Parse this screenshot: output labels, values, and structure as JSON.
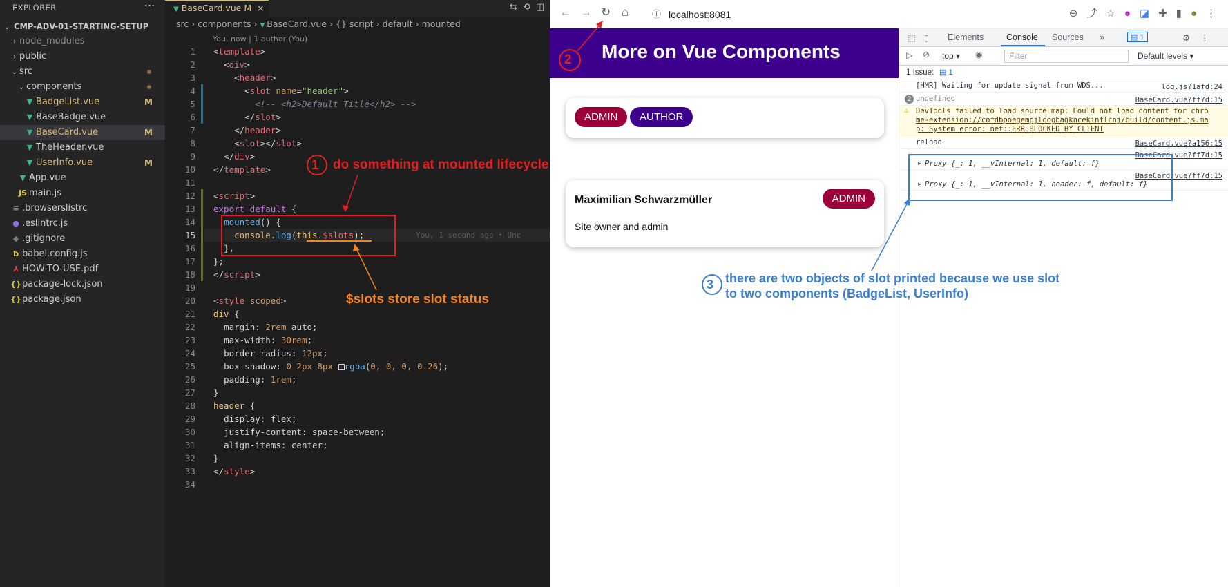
{
  "explorer": {
    "title": "EXPLORER",
    "more_icon": "ellipsis-icon",
    "project": "CMP-ADV-01-STARTING-SETUP",
    "items": [
      {
        "label": "node_modules",
        "kind": "folder",
        "depth": 1,
        "state": "collapsed",
        "badge": "",
        "muted": true
      },
      {
        "label": "public",
        "kind": "folder",
        "depth": 1,
        "state": "collapsed",
        "badge": "",
        "muted": false
      },
      {
        "label": "src",
        "kind": "folder",
        "depth": 1,
        "state": "expanded",
        "badge": "dot",
        "muted": false
      },
      {
        "label": "components",
        "kind": "folder",
        "depth": 2,
        "state": "expanded",
        "badge": "dot",
        "muted": false
      },
      {
        "label": "BadgeList.vue",
        "kind": "vue",
        "depth": 3,
        "badge": "M",
        "modified": true
      },
      {
        "label": "BaseBadge.vue",
        "kind": "vue",
        "depth": 3,
        "badge": "",
        "modified": false
      },
      {
        "label": "BaseCard.vue",
        "kind": "vue",
        "depth": 3,
        "badge": "M",
        "modified": true,
        "selected": true
      },
      {
        "label": "TheHeader.vue",
        "kind": "vue",
        "depth": 3,
        "badge": "",
        "modified": false
      },
      {
        "label": "UserInfo.vue",
        "kind": "vue",
        "depth": 3,
        "badge": "M",
        "modified": true
      },
      {
        "label": "App.vue",
        "kind": "vue",
        "depth": 2,
        "badge": "",
        "modified": false
      },
      {
        "label": "main.js",
        "kind": "js",
        "depth": 2,
        "badge": "",
        "modified": false
      },
      {
        "label": ".browserslistrc",
        "kind": "list",
        "depth": 1,
        "badge": "",
        "modified": false
      },
      {
        "label": ".eslintrc.js",
        "kind": "gear",
        "depth": 1,
        "badge": "",
        "modified": false
      },
      {
        "label": ".gitignore",
        "kind": "git",
        "depth": 1,
        "badge": "",
        "modified": false
      },
      {
        "label": "babel.config.js",
        "kind": "babel",
        "depth": 1,
        "badge": "",
        "modified": false
      },
      {
        "label": "HOW-TO-USE.pdf",
        "kind": "pdf",
        "depth": 1,
        "badge": "",
        "modified": false
      },
      {
        "label": "package-lock.json",
        "kind": "json",
        "depth": 1,
        "badge": "",
        "modified": false
      },
      {
        "label": "package.json",
        "kind": "json",
        "depth": 1,
        "badge": "",
        "modified": false
      }
    ]
  },
  "editor": {
    "tab": {
      "label": "BaseCard.vue",
      "status": "M",
      "close": "×"
    },
    "breadcrumbs": [
      "src",
      "components",
      "BaseCard.vue",
      "{} script",
      "default",
      "mounted"
    ],
    "blame_header": "You, now | 1 author (You)",
    "inline_blame": "You, 1 second ago • Unc",
    "active_line": 15,
    "lines": [
      {
        "n": 1,
        "html": "<span class='t-punc'>&lt;</span><span class='t-tag'>template</span><span class='t-punc'>&gt;</span>"
      },
      {
        "n": 2,
        "html": "  <span class='t-punc'>&lt;</span><span class='t-tag'>div</span><span class='t-punc'>&gt;</span>"
      },
      {
        "n": 3,
        "html": "    <span class='t-punc'>&lt;</span><span class='t-tag'>header</span><span class='t-punc'>&gt;</span>"
      },
      {
        "n": 4,
        "html": "      <span class='t-punc'>&lt;</span><span class='t-tag'>slot</span> <span class='t-attr'>name</span><span class='t-punc'>=</span><span class='t-str'>\"header\"</span><span class='t-punc'>&gt;</span>"
      },
      {
        "n": 5,
        "html": "        <span class='t-com'>&lt;!-- &lt;h2&gt;Default Title&lt;/h2&gt; --&gt;</span>"
      },
      {
        "n": 6,
        "html": "      <span class='t-punc'>&lt;/</span><span class='t-tag'>slot</span><span class='t-punc'>&gt;</span>"
      },
      {
        "n": 7,
        "html": "    <span class='t-punc'>&lt;/</span><span class='t-tag'>header</span><span class='t-punc'>&gt;</span>"
      },
      {
        "n": 8,
        "html": "    <span class='t-punc'>&lt;</span><span class='t-tag'>slot</span><span class='t-punc'>&gt;&lt;/</span><span class='t-tag'>slot</span><span class='t-punc'>&gt;</span>"
      },
      {
        "n": 9,
        "html": "  <span class='t-punc'>&lt;/</span><span class='t-tag'>div</span><span class='t-punc'>&gt;</span>"
      },
      {
        "n": 10,
        "html": "<span class='t-punc'>&lt;/</span><span class='t-tag'>template</span><span class='t-punc'>&gt;</span>"
      },
      {
        "n": 11,
        "html": ""
      },
      {
        "n": 12,
        "html": "<span class='t-punc'>&lt;</span><span class='t-tag'>script</span><span class='t-punc'>&gt;</span>"
      },
      {
        "n": 13,
        "html": "<span class='t-kw'>export default</span> <span class='t-punc'>{</span>"
      },
      {
        "n": 14,
        "html": "  <span class='t-fn'>mounted</span><span class='t-punc'>() {</span>"
      },
      {
        "n": 15,
        "html": "    <span class='t-prop'>console</span><span class='t-punc'>.</span><span class='t-fn'>log</span><span class='t-punc'>(</span><span class='t-this'>this</span><span class='t-punc'>.</span><span class='t-slots'>$slots</span><span class='t-punc'>);</span>"
      },
      {
        "n": 16,
        "html": "  <span class='t-punc'>},</span>"
      },
      {
        "n": 17,
        "html": "<span class='t-punc'>};</span>"
      },
      {
        "n": 18,
        "html": "<span class='t-punc'>&lt;/</span><span class='t-tag'>script</span><span class='t-punc'>&gt;</span>"
      },
      {
        "n": 19,
        "html": ""
      },
      {
        "n": 20,
        "html": "<span class='t-punc'>&lt;</span><span class='t-tag'>style</span> <span class='t-attr'>scoped</span><span class='t-punc'>&gt;</span>"
      },
      {
        "n": 21,
        "html": "<span class='t-sel'>div</span> <span class='t-punc'>{</span>"
      },
      {
        "n": 22,
        "html": "  <span class='t-punc'>margin: </span><span class='t-num'>2rem</span><span class='t-punc'> auto;</span>"
      },
      {
        "n": 23,
        "html": "  <span class='t-punc'>max-width: </span><span class='t-num'>30rem</span><span class='t-punc'>;</span>"
      },
      {
        "n": 24,
        "html": "  <span class='t-punc'>border-radius: </span><span class='t-num'>12px</span><span class='t-punc'>;</span>"
      },
      {
        "n": 25,
        "html": "  <span class='t-punc'>box-shadow: </span><span class='t-num'>0 2px 8px</span> <span style='display:inline-block;width:9px;height:9px;border:1px solid #d4d4d4;vertical-align:-1px'></span><span class='t-fn'>rgba</span><span class='t-punc'>(</span><span class='t-num'>0, 0, 0, 0.26</span><span class='t-punc'>);</span>"
      },
      {
        "n": 26,
        "html": "  <span class='t-punc'>padding: </span><span class='t-num'>1rem</span><span class='t-punc'>;</span>"
      },
      {
        "n": 27,
        "html": "<span class='t-punc'>}</span>"
      },
      {
        "n": 28,
        "html": "<span class='t-sel'>header</span> <span class='t-punc'>{</span>"
      },
      {
        "n": 29,
        "html": "  <span class='t-punc'>display: flex;</span>"
      },
      {
        "n": 30,
        "html": "  <span class='t-punc'>justify-content: space-between;</span>"
      },
      {
        "n": 31,
        "html": "  <span class='t-punc'>align-items: center;</span>"
      },
      {
        "n": 32,
        "html": "<span class='t-punc'>}</span>"
      },
      {
        "n": 33,
        "html": "<span class='t-punc'>&lt;/</span><span class='t-tag'>style</span><span class='t-punc'>&gt;</span>"
      },
      {
        "n": 34,
        "html": ""
      }
    ]
  },
  "browser": {
    "url": "localhost:8081",
    "page": {
      "title": "More on Vue Components",
      "badges": [
        "ADMIN",
        "AUTHOR"
      ],
      "user_name": "Maximilian Schwarzmüller",
      "user_badge": "ADMIN",
      "user_info": "Site owner and admin"
    },
    "devtools": {
      "tabs": [
        "Elements",
        "Console",
        "Sources"
      ],
      "active_tab": "Console",
      "issues_tab_count": "1",
      "context": "top",
      "filter_placeholder": "Filter",
      "levels": "Default levels",
      "issues_label": "1 Issue:",
      "issues_count": "1",
      "messages": [
        {
          "text": "[HMR] Waiting for update signal from WDS...",
          "source": "log.js?1afd:24",
          "kind": "log"
        },
        {
          "count": "2",
          "text": "undefined",
          "source": "BaseCard.vue?ff7d:15",
          "kind": "log"
        },
        {
          "text": "DevTools failed to load source map: Could not load content for chrome-extension://cofdbpoegempjloogbagkncekinflcnj/build/content.js.map: System error: net::ERR_BLOCKED_BY_CLIENT",
          "text_lines": [
            "DevTools failed to load source map: Could not load content for chro",
            "me-extension://cofdbpoegempjloogbagkncekinflcnj/build/content.js.ma",
            "p: System error: net::ERR_BLOCKED_BY_CLIENT"
          ],
          "source": "",
          "kind": "warn"
        },
        {
          "text": "reload",
          "source": "BaseCard.vue?a156:15",
          "kind": "log"
        },
        {
          "text": "Proxy {_: 1, __vInternal: 1, default: f}",
          "source": "BaseCard.vue?ff7d:15",
          "kind": "object"
        },
        {
          "text": "Proxy {_: 1, __vInternal: 1, header: f, default: f}",
          "source": "BaseCard.vue?ff7d:15",
          "kind": "object"
        }
      ]
    }
  },
  "annotations": {
    "a1": {
      "num": "1",
      "text": "do something at mounted lifecycle",
      "color": "#e02020"
    },
    "a2": {
      "num": "2",
      "color": "#e02020"
    },
    "a3": {
      "num": "3",
      "line1": "there are two objects of slot printed because we use slot",
      "line2": "to two components (BadgeList, UserInfo)",
      "color": "#3a7fd5"
    },
    "slots_note": {
      "text": "$slots store slot status",
      "color": "#f5841f"
    }
  },
  "colors": {
    "vue_green": "#41b883",
    "header_purple": "#3d008d",
    "admin_red": "#9b0039",
    "modified_yellow": "#d7ba7d"
  }
}
